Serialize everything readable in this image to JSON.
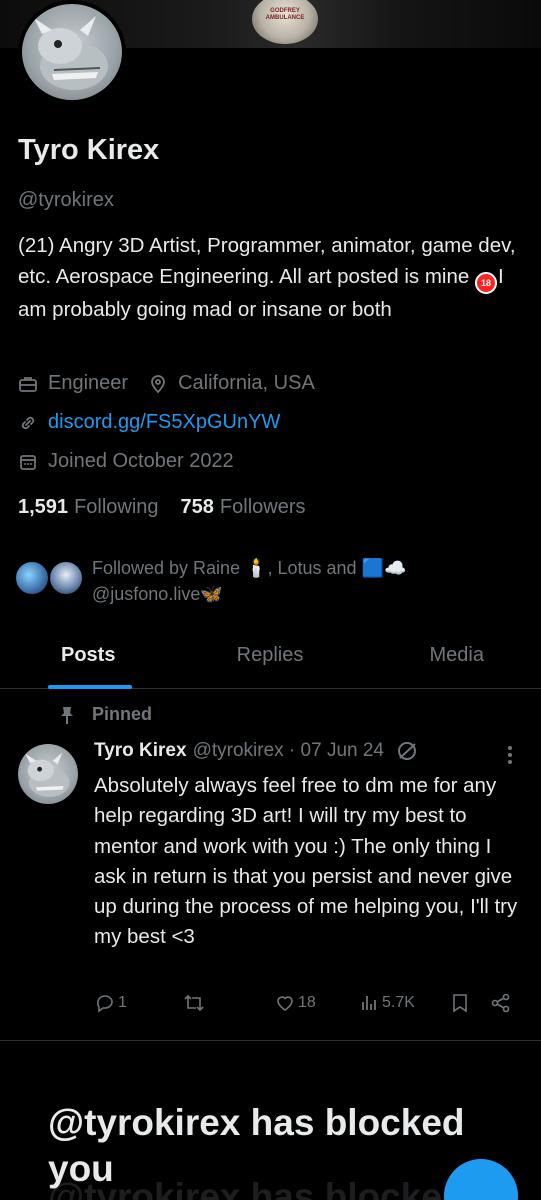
{
  "banner": {
    "emblem_text": "GODFREY AMBULANCE"
  },
  "profile": {
    "name": "Tyro Kirex",
    "handle": "@tyrokirex",
    "bio_1": "(21) Angry 3D Artist, Programmer, animator, game dev, etc. Aerospace Engineering. All art posted is mine ",
    "bio_emoji": "18",
    "bio_2": "I am probably going mad or insane or both",
    "profession": "Engineer",
    "location": "California, USA",
    "website": "discord.gg/FS5XpGUnYW",
    "joined": "Joined October 2022",
    "following_count": "1,591",
    "following_label": "Following",
    "followers_count": "758",
    "followers_label": "Followers",
    "followed_by": "Followed by Raine 🕯️, Lotus and 🟦☁️ @jusfono.live🦋"
  },
  "tabs": [
    {
      "label": "Posts",
      "active": true
    },
    {
      "label": "Replies",
      "active": false
    },
    {
      "label": "Media",
      "active": false
    }
  ],
  "post": {
    "pinned_label": "Pinned",
    "author": "Tyro Kirex",
    "handle_date": "@tyrokirex · 07 Jun 24",
    "text": "Absolutely always feel free to dm me for any help regarding 3D art! I will try my best to mentor and work with you :) The only thing I ask in return is that you persist and never give up during the process of me helping you, I'll try my best <3",
    "replies": "1",
    "reposts": "",
    "likes": "18",
    "views": "5.7K"
  },
  "blocked": {
    "message": "@tyrokirex has blocked you",
    "shadow": "@tyrokirex has blocked"
  },
  "colors": {
    "accent": "#1d9bf0",
    "text": "#e7e9ea",
    "muted": "#71767b",
    "background": "#000000"
  }
}
